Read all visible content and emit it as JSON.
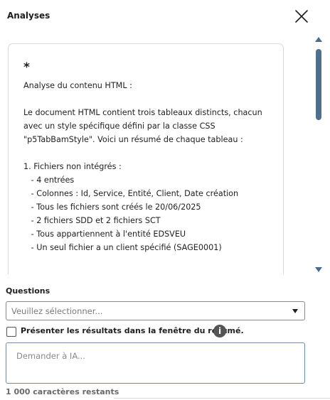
{
  "header": {
    "title": "Analyses",
    "close_icon": "close-icon"
  },
  "response": {
    "lines": [
      "*",
      "Analyse du contenu HTML :",
      "",
      "Le document HTML contient trois tableaux distincts, chacun",
      "avec un style spécifique défini par la classe CSS",
      "\"p5TabBamStyle\". Voici un résumé de chaque tableau :",
      "",
      "1. Fichiers non intégrés :",
      "   - 4 entrées",
      "   - Colonnes : Id, Service, Entité, Client, Date création",
      "   - Tous les fichiers sont créés le 20/06/2025",
      "   - 2 fichiers SDD et 2 fichiers SCT",
      "   - Tous appartiennent à l'entité EDSVEU",
      "   - Un seul fichier a un client spécifié (SAGE0001)"
    ]
  },
  "scrollbar": {
    "up_icon": "triangle-up-icon",
    "down_icon": "triangle-down-icon"
  },
  "form": {
    "questions_label": "Questions",
    "select": {
      "value": "Veuillez sélectionner...",
      "caret_icon": "caret-down-icon"
    },
    "checkbox": {
      "label": "Présenter les résultats dans la fenêtre du résumé.",
      "checked": false,
      "info_icon": "info-icon",
      "info_glyph": "i"
    },
    "textarea": {
      "placeholder": "Demander à IA..."
    },
    "chars_remaining": "1 000 caractères restants"
  }
}
